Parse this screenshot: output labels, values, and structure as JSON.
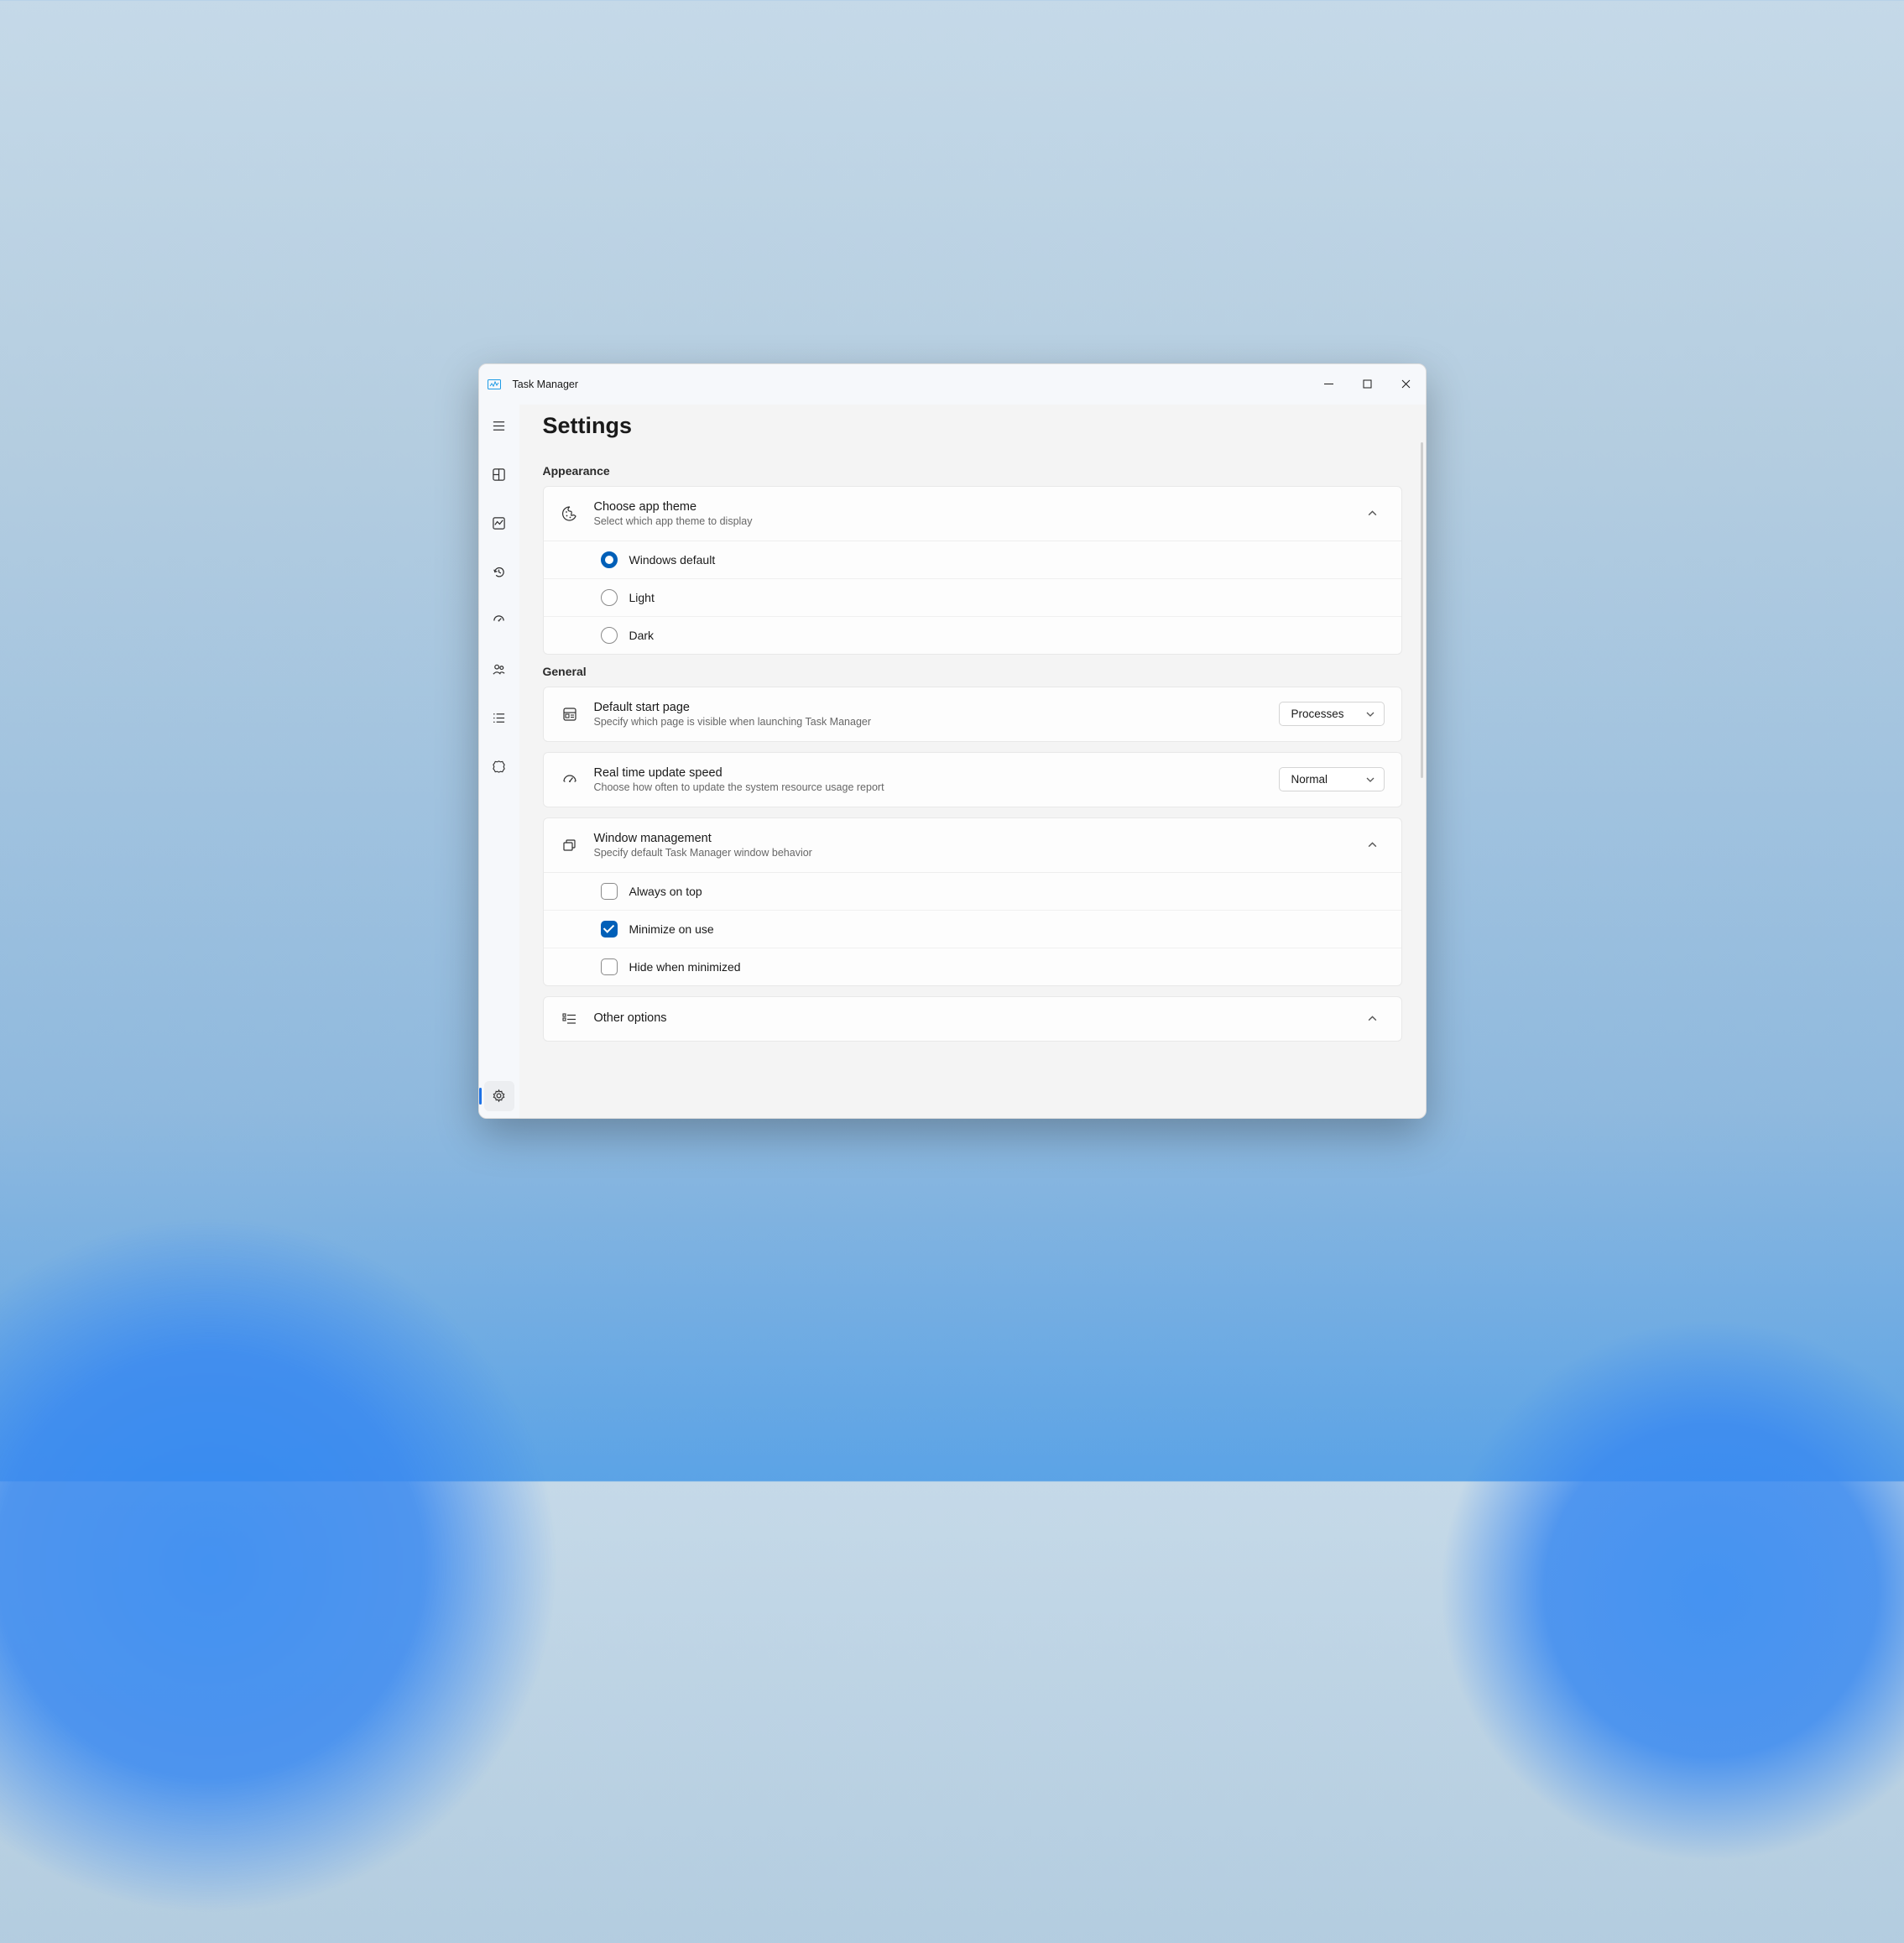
{
  "app": {
    "title": "Task Manager"
  },
  "page": {
    "title": "Settings"
  },
  "sections": {
    "appearance": {
      "label": "Appearance",
      "theme": {
        "title": "Choose app theme",
        "sub": "Select which app theme to display",
        "options": {
          "default": "Windows default",
          "light": "Light",
          "dark": "Dark"
        }
      }
    },
    "general": {
      "label": "General",
      "startpage": {
        "title": "Default start page",
        "sub": "Specify which page is visible when launching Task Manager",
        "value": "Processes"
      },
      "update": {
        "title": "Real time update speed",
        "sub": "Choose how often to update the system resource usage report",
        "value": "Normal"
      },
      "windowmgmt": {
        "title": "Window management",
        "sub": "Specify default Task Manager window behavior",
        "opts": {
          "ontop": "Always on top",
          "min": "Minimize on use",
          "hide": "Hide when minimized"
        }
      },
      "other": {
        "title": "Other options",
        "sub": ""
      }
    }
  }
}
